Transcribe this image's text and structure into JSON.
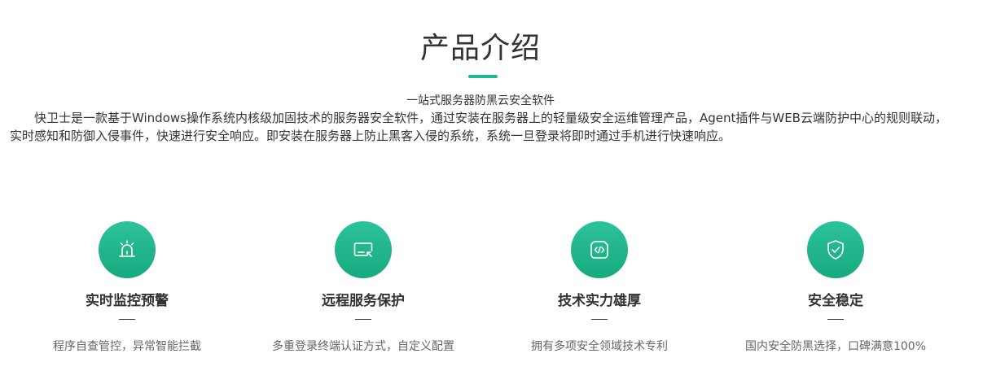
{
  "section": {
    "title": "产品介绍",
    "subtitle": "一站式服务器防黑云安全软件",
    "intro": "快卫士是一款基于Windows操作系统内核级加固技术的服务器安全软件，通过安装在服务器上的轻量级安全运维管理产品，Agent插件与WEB云端防护中心的规则联动，实时感知和防御入侵事件，快速进行安全响应。即安装在服务器上防止黑客入侵的系统，系统一旦登录将即时通过手机进行快速响应。",
    "accent_color": "#1fb88f"
  },
  "features": [
    {
      "icon": "alarm-icon",
      "title": "实时监控预警",
      "desc": "程序自查管控，异常智能拦截"
    },
    {
      "icon": "remote-screen-icon",
      "title": "远程服务保护",
      "desc": "多重登录终端认证方式，自定义配置"
    },
    {
      "icon": "code-file-icon",
      "title": "技术实力雄厚",
      "desc": "拥有多项安全领域技术专利"
    },
    {
      "icon": "shield-check-icon",
      "title": "安全稳定",
      "desc": "国内安全防黑选择，口碑满意100%"
    }
  ]
}
